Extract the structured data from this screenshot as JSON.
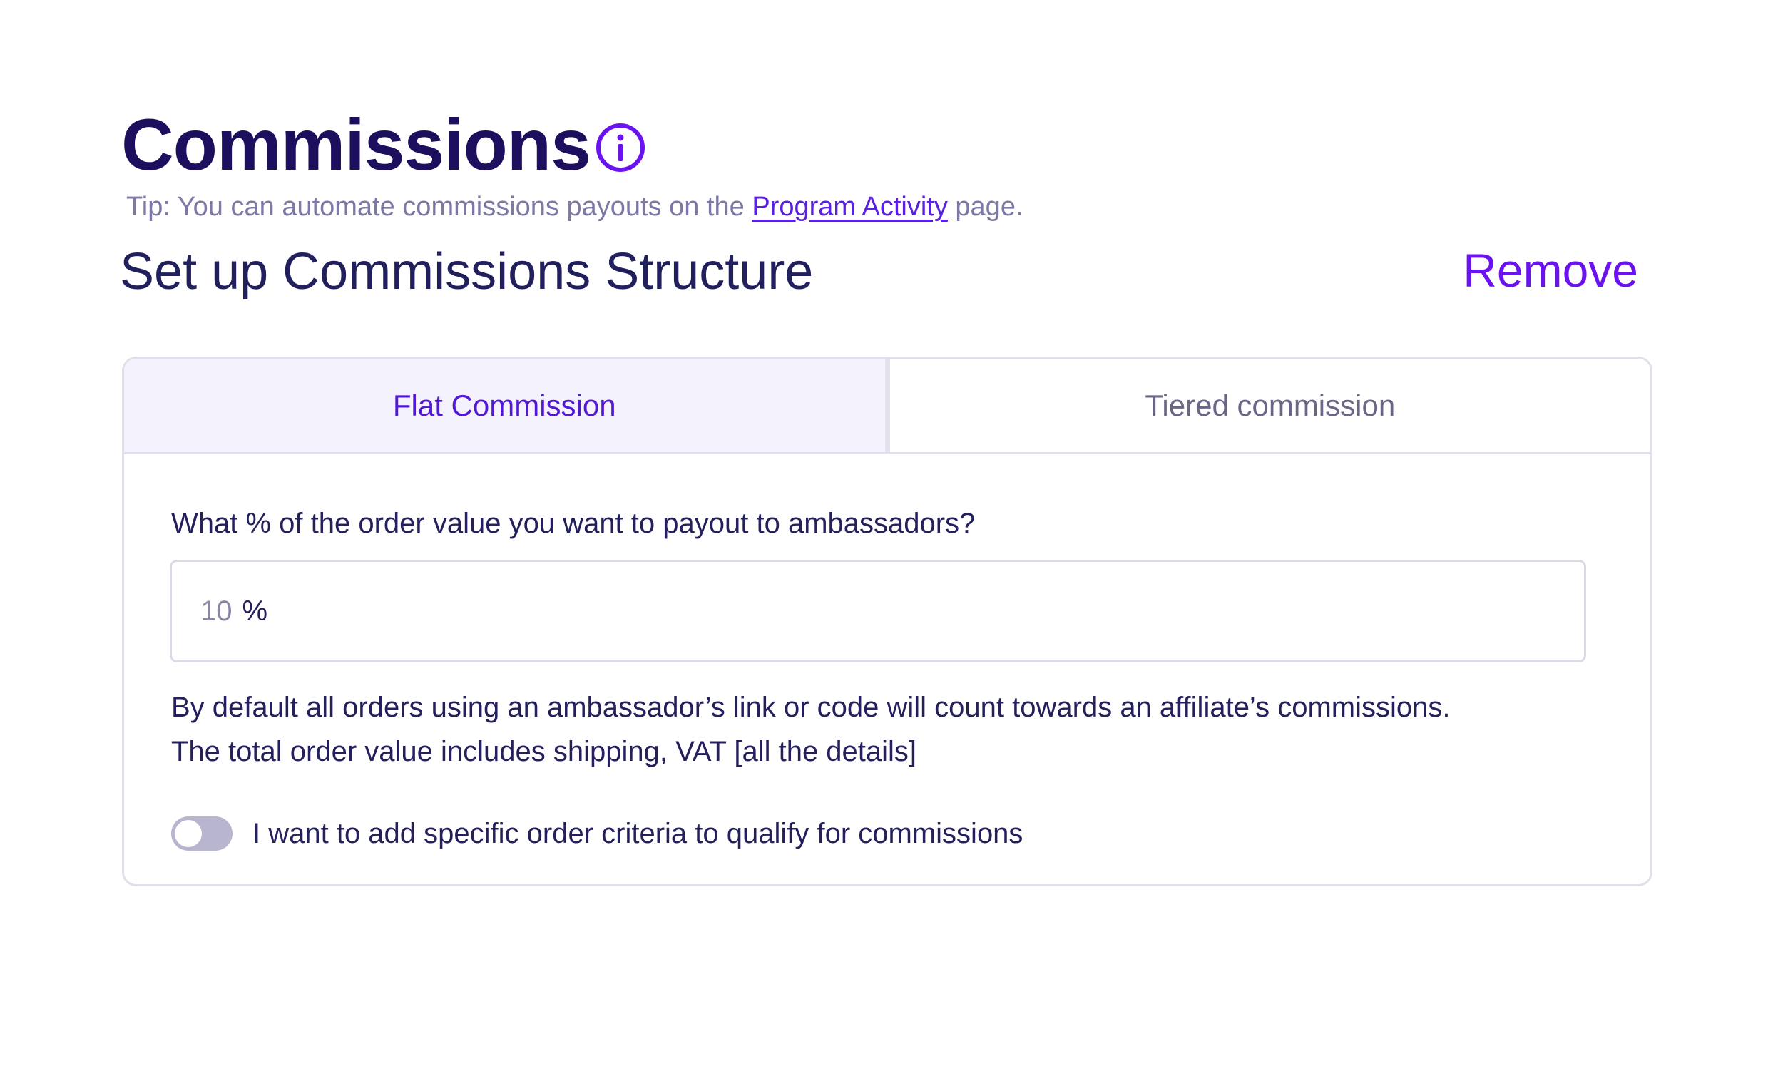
{
  "header": {
    "title": "Commissions",
    "info_icon": "info-circle-icon",
    "tip_prefix": "Tip: You can automate commissions payouts on the ",
    "tip_link": "Program Activity",
    "tip_suffix": " page."
  },
  "section": {
    "title": "Set up Commissions Structure",
    "remove_label": "Remove"
  },
  "tabs": [
    {
      "label": "Flat Commission",
      "active": true
    },
    {
      "label": "Tiered commission",
      "active": false
    }
  ],
  "form": {
    "question": "What % of the order value you want to payout to ambassadors?",
    "percent_value": "10",
    "percent_suffix": "%",
    "helper_line_1": "By default all orders using an ambassador’s link or code will count towards an affiliate’s commissions.",
    "helper_line_2": "The total order value includes shipping, VAT [all the details]",
    "toggle_label": "I want to add specific order criteria to qualify for commissions",
    "toggle_on": false
  },
  "colors": {
    "accent": "#6a12f0",
    "title": "#1e0e5e",
    "text": "#24205c",
    "muted": "#7d79a6",
    "border": "#e1dfea",
    "active_tab_bg": "#f4f2fd",
    "toggle_off": "#b8b6ce"
  }
}
